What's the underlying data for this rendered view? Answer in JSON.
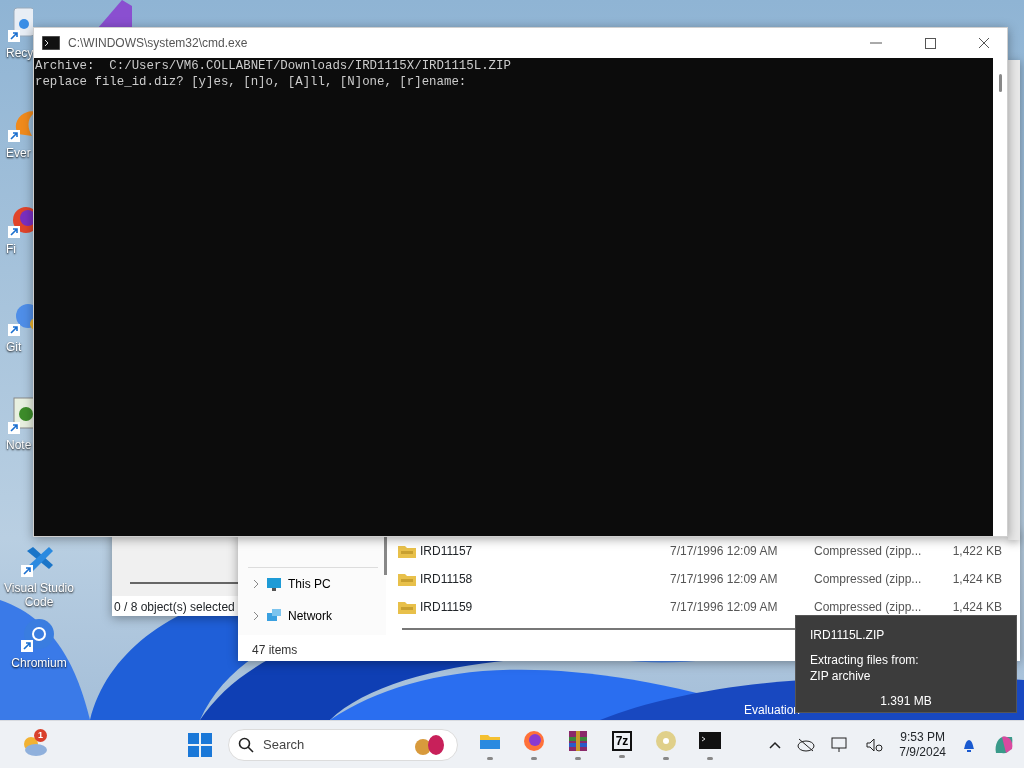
{
  "desktop_icons": [
    {
      "kind": "recycle",
      "label": "Recy"
    },
    {
      "kind": "everything",
      "label": "Ever"
    },
    {
      "kind": "firefox",
      "label": "Fi"
    },
    {
      "kind": "git",
      "label": "Git"
    },
    {
      "kind": "notepad",
      "label": "Note"
    },
    {
      "kind": "vscode",
      "label": "Visual Studio Code"
    },
    {
      "kind": "chromium",
      "label": "Chromium"
    }
  ],
  "console_window": {
    "title": "C:\\WINDOWS\\system32\\cmd.exe",
    "lines": [
      "Archive:  C:/Users/VM6.COLLABNET/Downloads/IRD1115X/IRD1115L.ZIP",
      "replace file_id.diz? [y]es, [n]o, [A]ll, [N]one, [r]ename:"
    ]
  },
  "archiver_window": {
    "status": "0 / 8 object(s) selected"
  },
  "explorer_window": {
    "nav_items": [
      {
        "kind": "pc",
        "label": "This PC"
      },
      {
        "kind": "network",
        "label": "Network"
      }
    ],
    "files": [
      {
        "name": "IRD11157",
        "modified": "7/17/1996 12:09 AM",
        "type": "Compressed (zipp...",
        "size": "1,422 KB"
      },
      {
        "name": "IRD11158",
        "modified": "7/17/1996 12:09 AM",
        "type": "Compressed (zipp...",
        "size": "1,424 KB"
      },
      {
        "name": "IRD11159",
        "modified": "7/17/1996 12:09 AM",
        "type": "Compressed (zipp...",
        "size": "1,424 KB"
      }
    ],
    "status": "47 items"
  },
  "evaluation_text": "Evaluation",
  "toast": {
    "title": "IRD1115L.ZIP",
    "lines": [
      "Extracting files from:",
      "ZIP archive"
    ],
    "size": "1.391 MB"
  },
  "taskbar": {
    "weather_badge": "1",
    "search": {
      "placeholder": "Search"
    },
    "apps": [
      {
        "kind": "folder"
      },
      {
        "kind": "firefox"
      },
      {
        "kind": "winrar"
      },
      {
        "kind": "sevenzip",
        "label": "7z"
      },
      {
        "kind": "disc"
      },
      {
        "kind": "terminal"
      }
    ],
    "time": "9:53 PM",
    "date": "7/9/2024"
  }
}
